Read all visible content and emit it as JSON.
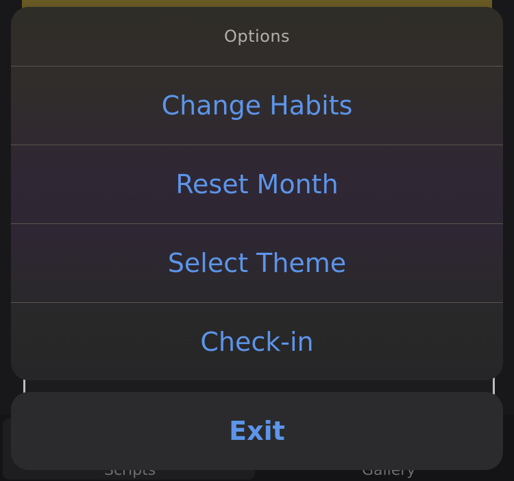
{
  "sheet": {
    "title": "Options",
    "actions": [
      {
        "label": "Change Habits"
      },
      {
        "label": "Reset Month"
      },
      {
        "label": "Select Theme"
      },
      {
        "label": "Check-in"
      }
    ],
    "cancel_label": "Exit"
  },
  "background": {
    "tabs": {
      "left": "Scripts",
      "right": "Gallery"
    }
  },
  "colors": {
    "action_text": "#5c95ea",
    "title_text": "#b3b1aa",
    "sheet_bg": "#2e2b2c",
    "cancel_bg": "#2b2b2d"
  }
}
